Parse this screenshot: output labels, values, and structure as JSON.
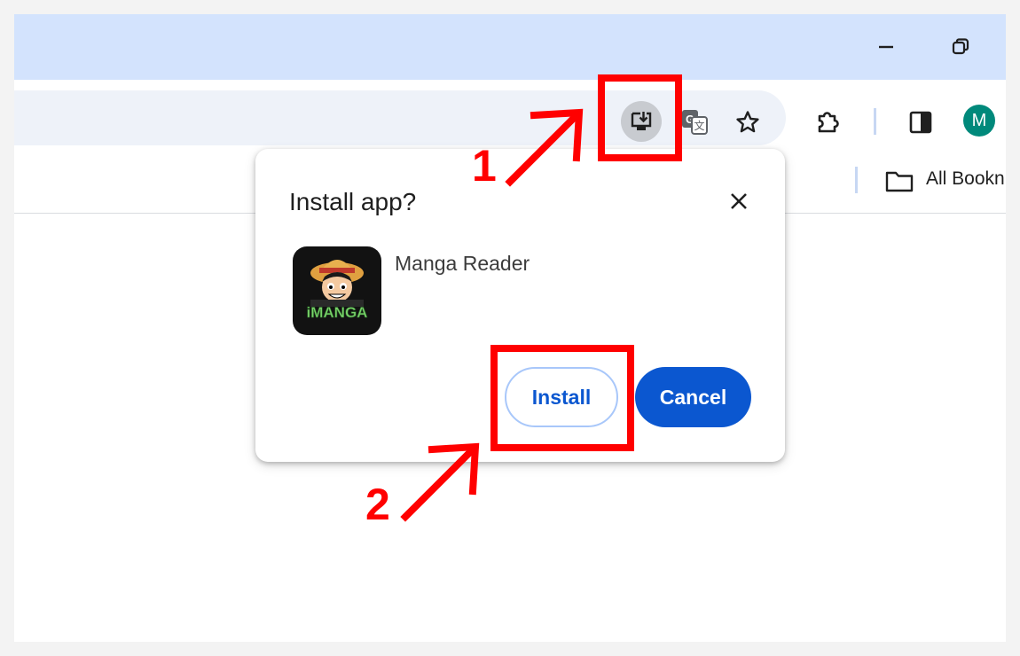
{
  "window": {
    "minimize_icon": "minimize-icon",
    "restore_icon": "restore-icon"
  },
  "toolbar": {
    "install_app_icon": "install-app-icon",
    "translate_icon": "translate-icon",
    "bookmark_star_icon": "star-icon",
    "extensions_icon": "puzzle-icon",
    "side_panel_icon": "side-panel-icon",
    "profile_initial": "M",
    "profile_color": "#00897b"
  },
  "bookmarks_bar": {
    "all_bookmarks_label": "All Bookn"
  },
  "install_dialog": {
    "title": "Install app?",
    "app_name": "Manga Reader",
    "app_icon_text": "iMANGA",
    "install_label": "Install",
    "cancel_label": "Cancel"
  },
  "annotations": {
    "step1": "1",
    "step2": "2",
    "color": "#ff0000"
  },
  "colors": {
    "titlebar": "#d3e3fd",
    "primary": "#0b57d0"
  }
}
